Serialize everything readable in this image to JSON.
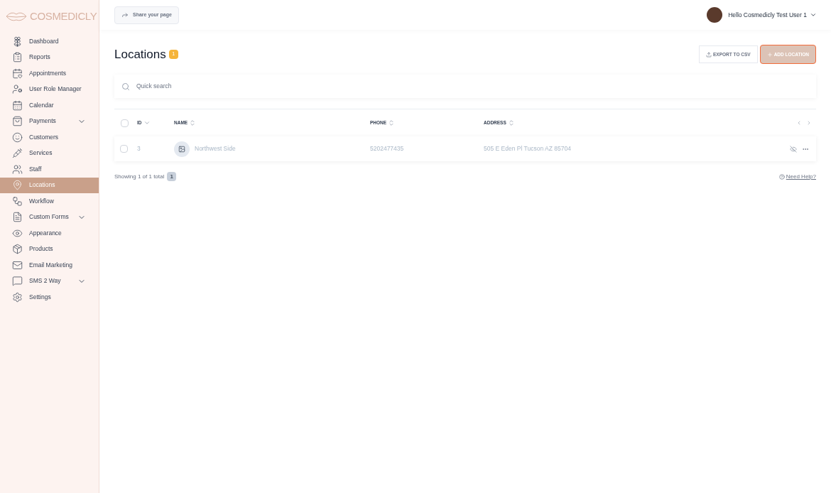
{
  "brand": "COSMEDICLY",
  "share_button": "Share your page",
  "user": {
    "greeting": "Hello Cosmedicly Test User 1"
  },
  "sidebar": {
    "items": [
      {
        "label": "Dashboard",
        "selected": false,
        "has_submenu": false
      },
      {
        "label": "Reports",
        "selected": false,
        "has_submenu": false
      },
      {
        "label": "Appointments",
        "selected": false,
        "has_submenu": false
      },
      {
        "label": "User Role Manager",
        "selected": false,
        "has_submenu": false
      },
      {
        "label": "Calendar",
        "selected": false,
        "has_submenu": false
      },
      {
        "label": "Payments",
        "selected": false,
        "has_submenu": true
      },
      {
        "label": "Customers",
        "selected": false,
        "has_submenu": false
      },
      {
        "label": "Services",
        "selected": false,
        "has_submenu": false
      },
      {
        "label": "Staff",
        "selected": false,
        "has_submenu": false
      },
      {
        "label": "Locations",
        "selected": true,
        "has_submenu": false
      },
      {
        "label": "Workflow",
        "selected": false,
        "has_submenu": false
      },
      {
        "label": "Custom Forms",
        "selected": false,
        "has_submenu": true
      },
      {
        "label": "Appearance",
        "selected": false,
        "has_submenu": false
      },
      {
        "label": "Products",
        "selected": false,
        "has_submenu": false
      },
      {
        "label": "Email Marketing",
        "selected": false,
        "has_submenu": false
      },
      {
        "label": "SMS 2 Way",
        "selected": false,
        "has_submenu": true
      },
      {
        "label": "Settings",
        "selected": false,
        "has_submenu": false
      }
    ]
  },
  "page": {
    "title": "Locations",
    "count": "1"
  },
  "actions": {
    "export": "EXPORT TO CSV",
    "add": "ADD LOCATION"
  },
  "search": {
    "placeholder": "Quick search"
  },
  "table": {
    "select_all": {
      "checked": false
    },
    "columns": [
      {
        "label": "ID",
        "sorted": true
      },
      {
        "label": "NAME",
        "sorted": false
      },
      {
        "label": "PHONE",
        "sorted": false
      },
      {
        "label": "ADDRESS",
        "sorted": false
      }
    ],
    "rows": [
      {
        "checked": false,
        "id": "3",
        "name": "Northwest Side",
        "phone": "5202477435",
        "address": "505 E Eden Pl Tucson AZ 85704"
      }
    ]
  },
  "footer": {
    "showing": "Showing 1 of 1 total",
    "total": "1",
    "help": "Need Help?"
  }
}
